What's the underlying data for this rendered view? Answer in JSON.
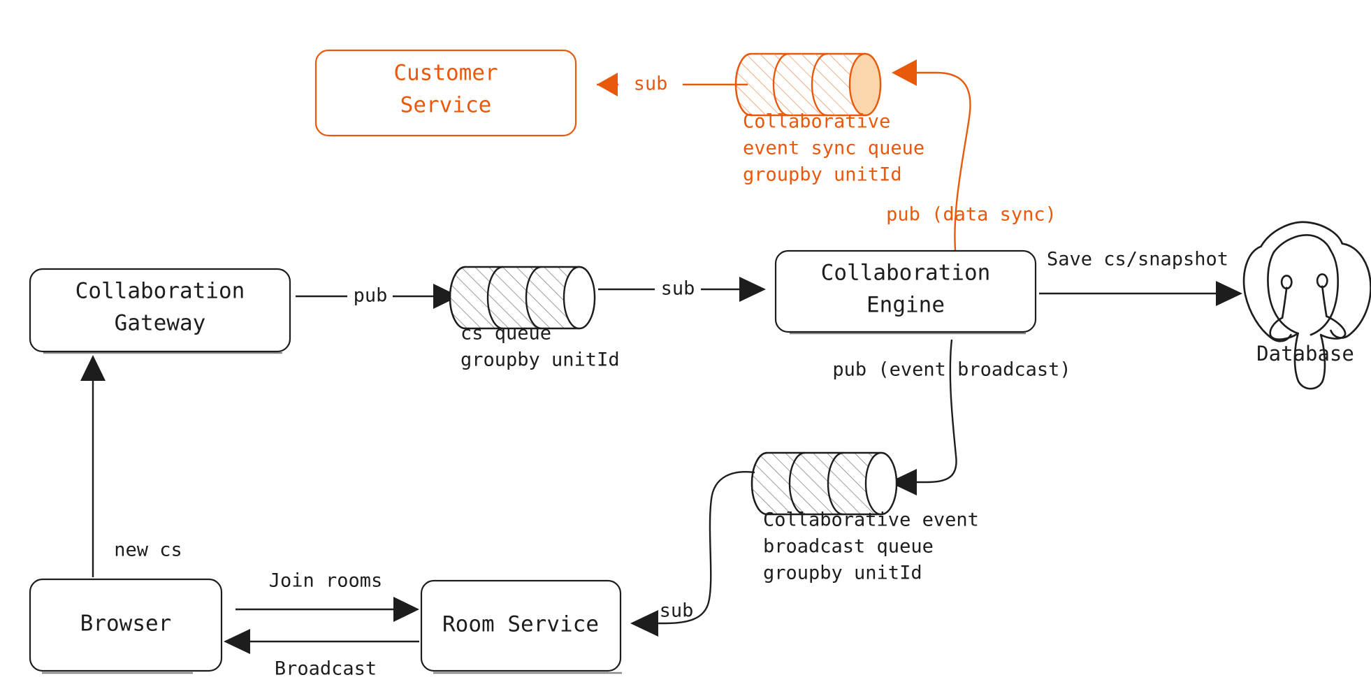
{
  "diagram": {
    "title": "Collaboration event sync architecture",
    "colors": {
      "accent_orange": "#E8590C",
      "orange_fill": "#FBD6AC",
      "ink": "#1d1d1d",
      "shadow": "#8a8a8a",
      "background": "#ffffff"
    }
  },
  "nodes": {
    "customer_service": {
      "label_line1": "Customer",
      "label_line2": "Service",
      "color": "#E8590C"
    },
    "collaboration_gateway": {
      "label_line1": "Collaboration",
      "label_line2": "Gateway",
      "color": "#1d1d1d"
    },
    "collaboration_engine": {
      "label_line1": "Collaboration",
      "label_line2": "Engine",
      "color": "#1d1d1d"
    },
    "browser": {
      "label": "Browser",
      "color": "#1d1d1d"
    },
    "room_service": {
      "label": "Room Service",
      "color": "#1d1d1d"
    },
    "database": {
      "label": "Database",
      "icon": "elephant-icon",
      "color": "#1d1d1d"
    }
  },
  "queues": {
    "sync_queue": {
      "label_line1": "Collaborative",
      "label_line2": "event sync queue",
      "label_line3": "groupby unitId",
      "color": "#E8590C"
    },
    "cs_queue": {
      "label_line1": "cs queue",
      "label_line2": "groupby unitId",
      "color": "#1d1d1d"
    },
    "broadcast_queue": {
      "label_line1": "Collaborative event",
      "label_line2": "broadcast queue",
      "label_line3": "groupby unitId",
      "color": "#1d1d1d"
    }
  },
  "edges": {
    "sync_to_customer_service": {
      "label": "sub",
      "color": "#E8590C"
    },
    "engine_to_sync_queue": {
      "label": "pub (data sync)",
      "color": "#E8590C"
    },
    "gateway_to_cs_queue": {
      "label": "pub",
      "color": "#1d1d1d"
    },
    "cs_queue_to_engine": {
      "label": "sub",
      "color": "#1d1d1d"
    },
    "engine_to_database": {
      "label": "Save cs/snapshot",
      "color": "#1d1d1d"
    },
    "engine_to_broadcast_queue": {
      "label": "pub (event broadcast)",
      "color": "#1d1d1d"
    },
    "broadcast_queue_to_room_service": {
      "label": "sub",
      "color": "#1d1d1d"
    },
    "browser_to_gateway": {
      "label": "new cs",
      "color": "#1d1d1d"
    },
    "browser_to_room_service": {
      "label": "Join rooms",
      "color": "#1d1d1d"
    },
    "room_service_to_browser": {
      "label": "Broadcast",
      "color": "#1d1d1d"
    }
  }
}
